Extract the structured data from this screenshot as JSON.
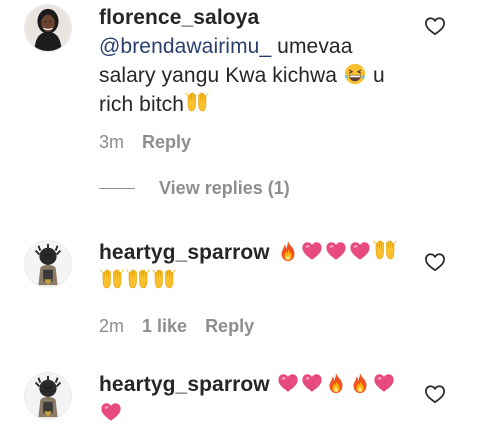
{
  "comments": [
    {
      "username": "florence_saloya",
      "mention": "@brendawairimu_",
      "text_line1": " umevaa",
      "text_line2": "salary yangu Kwa kichwa",
      "text_after_emoji": " u",
      "text_line3": "rich bitch",
      "time": "3m",
      "reply_label": "Reply",
      "view_replies_label": "View replies (1)"
    },
    {
      "username": "heartyg_sparrow",
      "time": "2m",
      "likes": "1 like",
      "reply_label": "Reply"
    },
    {
      "username": "heartyg_sparrow"
    }
  ],
  "icons": {
    "heart": "heart-outline-icon",
    "fire": "fire-emoji",
    "pink_heart": "pink-heart-emoji",
    "raised_hands": "raised-hands-emoji",
    "grinning": "grinning-squinting-emoji"
  },
  "colors": {
    "text": "#262626",
    "muted": "#8e8e8e",
    "mention": "#2b3f6e",
    "pink_heart": "#e8497f"
  }
}
